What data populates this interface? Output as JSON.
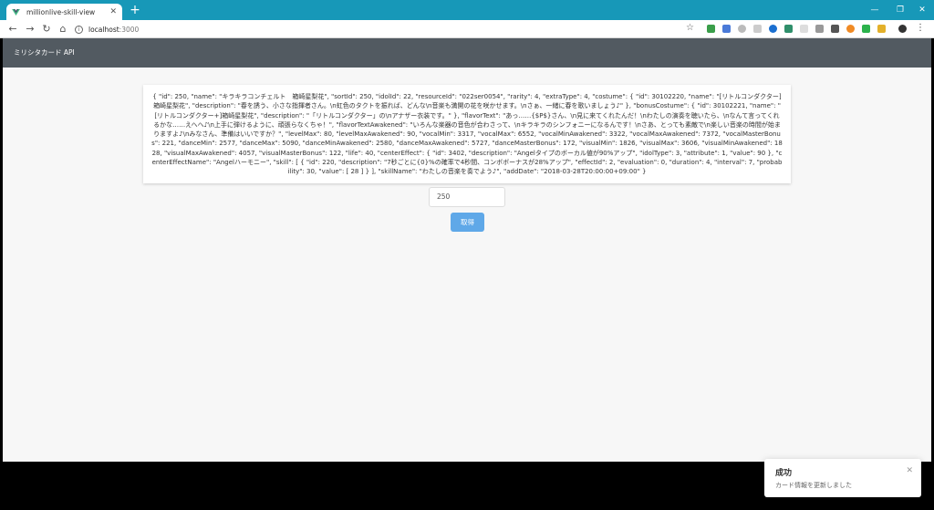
{
  "browser": {
    "tab_title": "millionlive-skill-view",
    "address_host": "localhost",
    "address_port": ":3000"
  },
  "app": {
    "title": "ミリシタカード API"
  },
  "card": {
    "json_text": "{ \"id\": 250, \"name\": \"キラキラコンチェルト　箱崎星梨花\", \"sortId\": 250, \"idolId\": 22, \"resourceId\": \"022ser0054\", \"rarity\": 4, \"extraType\": 4, \"costume\": { \"id\": 30102220, \"name\": \"[リトルコンダクター]箱崎星梨花\", \"description\": \"春を誘う、小さな指揮者さん。\\n虹色のタクトを振れば、どんな\\n音楽も満開の花を咲かせます。\\nさぁ、一緒に春を歌いましょう♪\" }, \"bonusCostume\": { \"id\": 30102221, \"name\": \"[リトルコンダクター+]箱崎星梨花\", \"description\": \"「リトルコンダクター」の\\nアナザー衣装です。\" }, \"flavorText\": \"あっ……{$P$}さん、\\n見に来てくれたんだ！\\nわたしの演奏を聴いたら、\\nなんて言ってくれるかな……えへへ♪\\n上手に弾けるように、頑張らなくちゃ！\", \"flavorTextAwakened\": \"いろんな楽器の音色が合わさって、\\nキラキラのシンフォニーになるんです！\\nさあ、とっても素敵で\\n楽しい音楽の時間が始まりますよ♪\\nみなさん、準備はいいですか？\", \"levelMax\": 80, \"levelMaxAwakened\": 90, \"vocalMin\": 3317, \"vocalMax\": 6552, \"vocalMinAwakened\": 3322, \"vocalMaxAwakened\": 7372, \"vocalMasterBonus\": 221, \"danceMin\": 2577, \"danceMax\": 5090, \"danceMinAwakened\": 2580, \"danceMaxAwakened\": 5727, \"danceMasterBonus\": 172, \"visualMin\": 1826, \"visualMax\": 3606, \"visualMinAwakened\": 1828, \"visualMaxAwakened\": 4057, \"visualMasterBonus\": 122, \"life\": 40, \"centerEffect\": { \"id\": 3402, \"description\": \"Angelタイプのボーカル値が90%アップ\", \"idolType\": 3, \"attribute\": 1, \"value\": 90 }, \"centerEffectName\": \"Angelハーモニー\", \"skill\": [ { \"id\": 220, \"description\": \"7秒ごとに{0}%の確率で4秒間、コンボボーナスが28%アップ\", \"effectId\": 2, \"evaluation\": 0, \"duration\": 4, \"interval\": 7, \"probability\": 30, \"value\": [ 28 ] } ], \"skillName\": \"わたしの音楽を奏でよう♪\", \"addDate\": \"2018-03-28T20:00:00+09:00\" }"
  },
  "form": {
    "id_value": "250",
    "get_button": "取得"
  },
  "toast": {
    "title": "成功",
    "message": "カード情報を更新しました"
  },
  "colors": {
    "tabstrip": "#1798b8",
    "appbar": "#525a61",
    "button": "#5fa8e8"
  }
}
